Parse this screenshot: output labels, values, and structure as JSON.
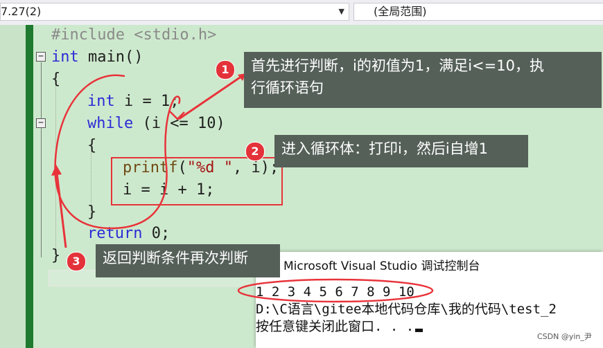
{
  "toolbar": {
    "project_dropdown": "7.27(2)",
    "scope_dropdown": "(全局范围)"
  },
  "code": {
    "line1": "#include <stdio.h>",
    "line2_kw": "int",
    "line2_rest": " main()",
    "line3": "{",
    "line4_kw": "int",
    "line4_rest": " i = 1;",
    "line5_kw": "while",
    "line5_rest": " (i <= 10)",
    "line6": "{",
    "line7_fn": "printf",
    "line7_open": "(",
    "line7_str": "\"%d \"",
    "line7_rest": ", i);",
    "line8": "i = i + 1;",
    "line9": "}",
    "line10_kw": "return",
    "line10_rest": " 0;",
    "line11": "}"
  },
  "callouts": [
    {
      "number": "1",
      "text_line1": "首先进行判断，i的初值为1，满足i<=10，执",
      "text_line2": "行循环语句"
    },
    {
      "number": "2",
      "text": "进入循环体：打印i，然后i自增1"
    },
    {
      "number": "3",
      "text": "返回判断条件再次判断"
    }
  ],
  "console": {
    "title": "Microsoft Visual Studio 调试控制台",
    "output_line": "1 2 3 4 5 6 7 8 9 10",
    "path_line": "D:\\C语言\\gitee本地代码仓库\\我的代码\\test_2",
    "prompt_line": "按任意键关闭此窗口. . ."
  },
  "watermark": "CSDN @yin_尹",
  "colors": {
    "editor_bg": "#cde9cd",
    "keyword": "#2b2bd6",
    "annotation_red": "#e8333a",
    "callout_bg": "#556059"
  }
}
